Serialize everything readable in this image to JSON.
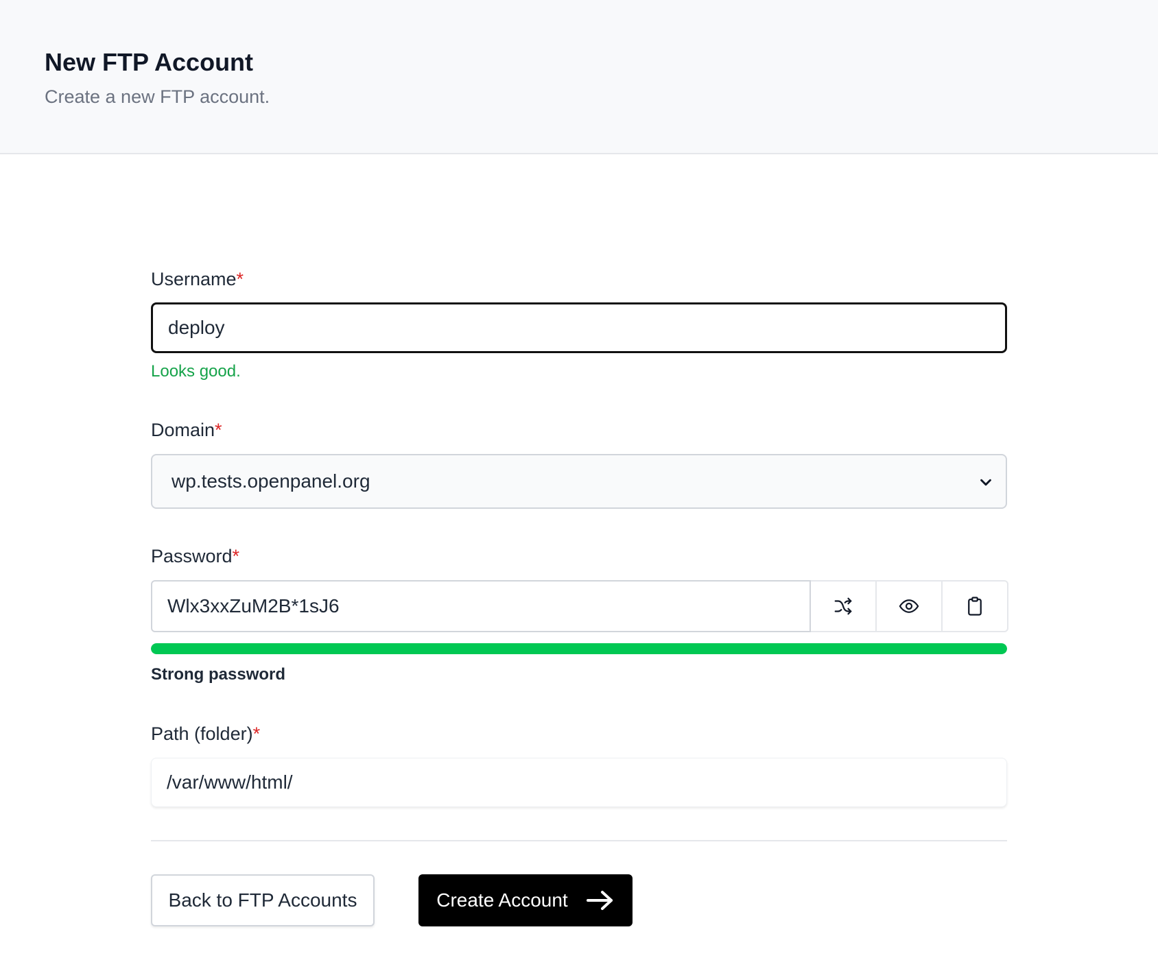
{
  "header": {
    "title": "New FTP Account",
    "subtitle": "Create a new FTP account."
  },
  "form": {
    "required_marker": "*",
    "username": {
      "label": "Username",
      "value": "deploy",
      "validation": "Looks good."
    },
    "domain": {
      "label": "Domain",
      "selected": "wp.tests.openpanel.org"
    },
    "password": {
      "label": "Password",
      "value": "Wlx3xxZuM2B*1sJ6",
      "strength_label": "Strong password",
      "strength_percent": 100,
      "strength_color": "#00c853",
      "buttons": [
        "shuffle-icon",
        "eye-icon",
        "clipboard-icon"
      ]
    },
    "path": {
      "label": "Path (folder)",
      "value": "/var/www/html/"
    }
  },
  "actions": {
    "back_label": "Back to FTP Accounts",
    "create_label": "Create Account"
  }
}
